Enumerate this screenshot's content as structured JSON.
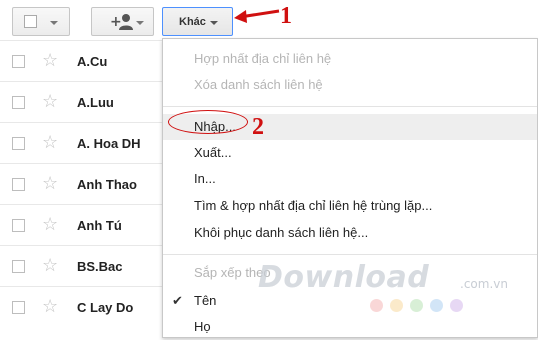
{
  "toolbar": {
    "more_label": "Khác"
  },
  "annotations": {
    "step1": "1",
    "step2": "2"
  },
  "contacts": [
    {
      "name": "A.Cu"
    },
    {
      "name": "A.Luu"
    },
    {
      "name": "A. Hoa DH"
    },
    {
      "name": "Anh Thao"
    },
    {
      "name": "Anh Tú"
    },
    {
      "name": "BS.Bac"
    },
    {
      "name": "C Lay Do"
    }
  ],
  "menu": {
    "merge_contacts": "Hợp nhất địa chỉ liên hệ",
    "delete_list": "Xóa danh sách liên hệ",
    "import": "Nhập...",
    "export": "Xuất...",
    "print": "In...",
    "find_duplicates": "Tìm & hợp nhất địa chỉ liên hệ trùng lặp...",
    "restore": "Khôi phục danh sách liên hệ...",
    "sort_by": "Sắp xếp theo",
    "sort_first": "Tên",
    "sort_last": "Họ"
  },
  "watermark": {
    "brand": "Download",
    "suffix": ".com.vn"
  },
  "colors": {
    "accent_blue": "#4d90fe",
    "annotation_red": "#d01010",
    "watermark_dots": [
      "#f2a6a6",
      "#f6d08a",
      "#a9dca3",
      "#9cc6ee",
      "#c9a8e6"
    ]
  }
}
